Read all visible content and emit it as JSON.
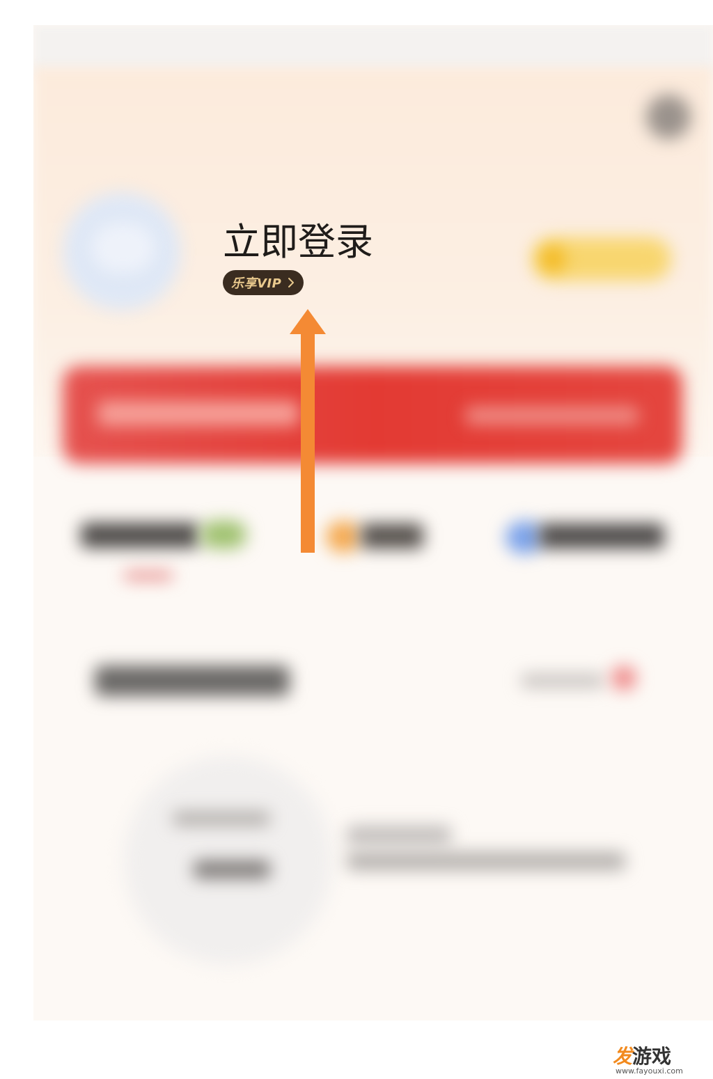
{
  "profile": {
    "login_title": "立即登录",
    "vip_label": "乐享VIP",
    "vip_chevron_icon": "chevron-right-icon"
  },
  "annotation": {
    "arrow_color": "#f48a34",
    "arrow_icon": "arrow-up-icon"
  },
  "watermark": {
    "logo_char": "发",
    "logo_text": "游戏",
    "url": "www.fayouxi.com"
  },
  "colors": {
    "accent_red": "#e33a33",
    "vip_pill_bg": "#3a2c20",
    "vip_gold": "#e9c98d",
    "checkin_yellow": "#f8d66f"
  }
}
